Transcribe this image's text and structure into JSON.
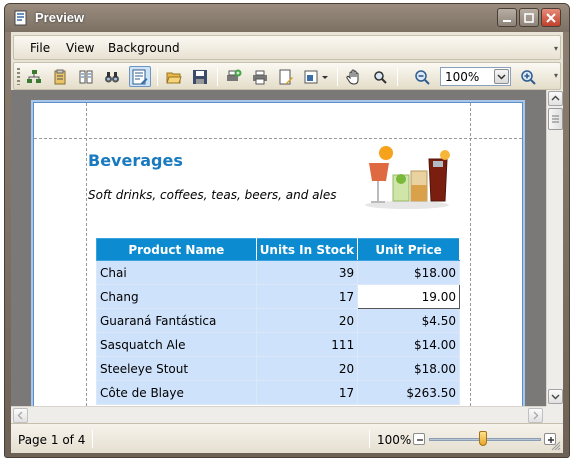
{
  "window": {
    "title": "Preview"
  },
  "menu": {
    "items": [
      "File",
      "View",
      "Background"
    ]
  },
  "toolbar": {
    "zoom_value": "100%"
  },
  "report": {
    "category_title": "Beverages",
    "category_description": "Soft drinks, coffees, teas, beers, and ales",
    "columns": [
      "Product Name",
      "Units In Stock",
      "Unit Price"
    ],
    "rows": [
      {
        "name": "Chai",
        "units": "39",
        "price": "$18.00"
      },
      {
        "name": "Chang",
        "units": "17",
        "price": "19.00"
      },
      {
        "name": "Guaraná Fantástica",
        "units": "20",
        "price": "$4.50"
      },
      {
        "name": "Sasquatch Ale",
        "units": "111",
        "price": "$14.00"
      },
      {
        "name": "Steeleye Stout",
        "units": "20",
        "price": "$18.00"
      },
      {
        "name": "Côte de Blaye",
        "units": "17",
        "price": "$263.50"
      }
    ]
  },
  "status": {
    "page": "Page 1 of 4",
    "zoom": "100%",
    "zoom_level_percent": 100
  },
  "colors": {
    "accent": "#0d8bd0",
    "row_bg": "#cfe2fb",
    "title_color": "#1a7ac0"
  }
}
